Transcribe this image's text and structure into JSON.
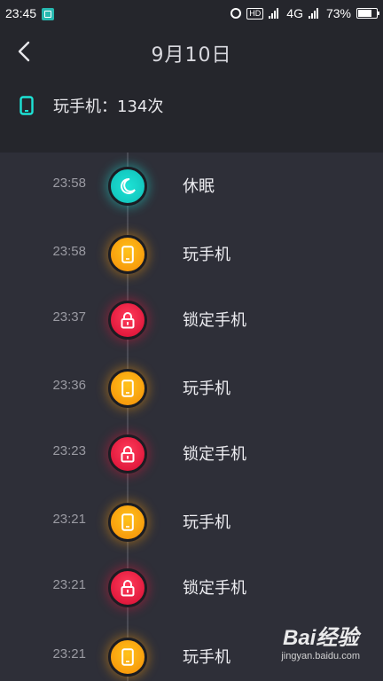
{
  "status_bar": {
    "time": "23:45",
    "hd": "HD",
    "network": "4G",
    "battery": "73%"
  },
  "header": {
    "title": "9月10日",
    "summary_icon": "phone-icon",
    "summary_text": "玩手机：134次"
  },
  "timeline": {
    "entries": [
      {
        "time": "23:58",
        "label": "休眠",
        "type": "sleep",
        "icon": "moon-icon"
      },
      {
        "time": "23:58",
        "label": "玩手机",
        "type": "phone",
        "icon": "phone-icon"
      },
      {
        "time": "23:37",
        "label": "锁定手机",
        "type": "lock",
        "icon": "lock-icon"
      },
      {
        "time": "23:36",
        "label": "玩手机",
        "type": "phone",
        "icon": "phone-icon"
      },
      {
        "time": "23:23",
        "label": "锁定手机",
        "type": "lock",
        "icon": "lock-icon"
      },
      {
        "time": "23:21",
        "label": "玩手机",
        "type": "phone",
        "icon": "phone-icon"
      },
      {
        "time": "23:21",
        "label": "锁定手机",
        "type": "lock",
        "icon": "lock-icon"
      },
      {
        "time": "23:21",
        "label": "玩手机",
        "type": "phone",
        "icon": "phone-icon"
      }
    ]
  },
  "colors": {
    "accent_teal": "#1de3d6",
    "phone_orange": "#f79a0c",
    "lock_red": "#e0183c"
  },
  "watermark": {
    "logo": "Bai经验",
    "url": "jingyan.baidu.com"
  }
}
